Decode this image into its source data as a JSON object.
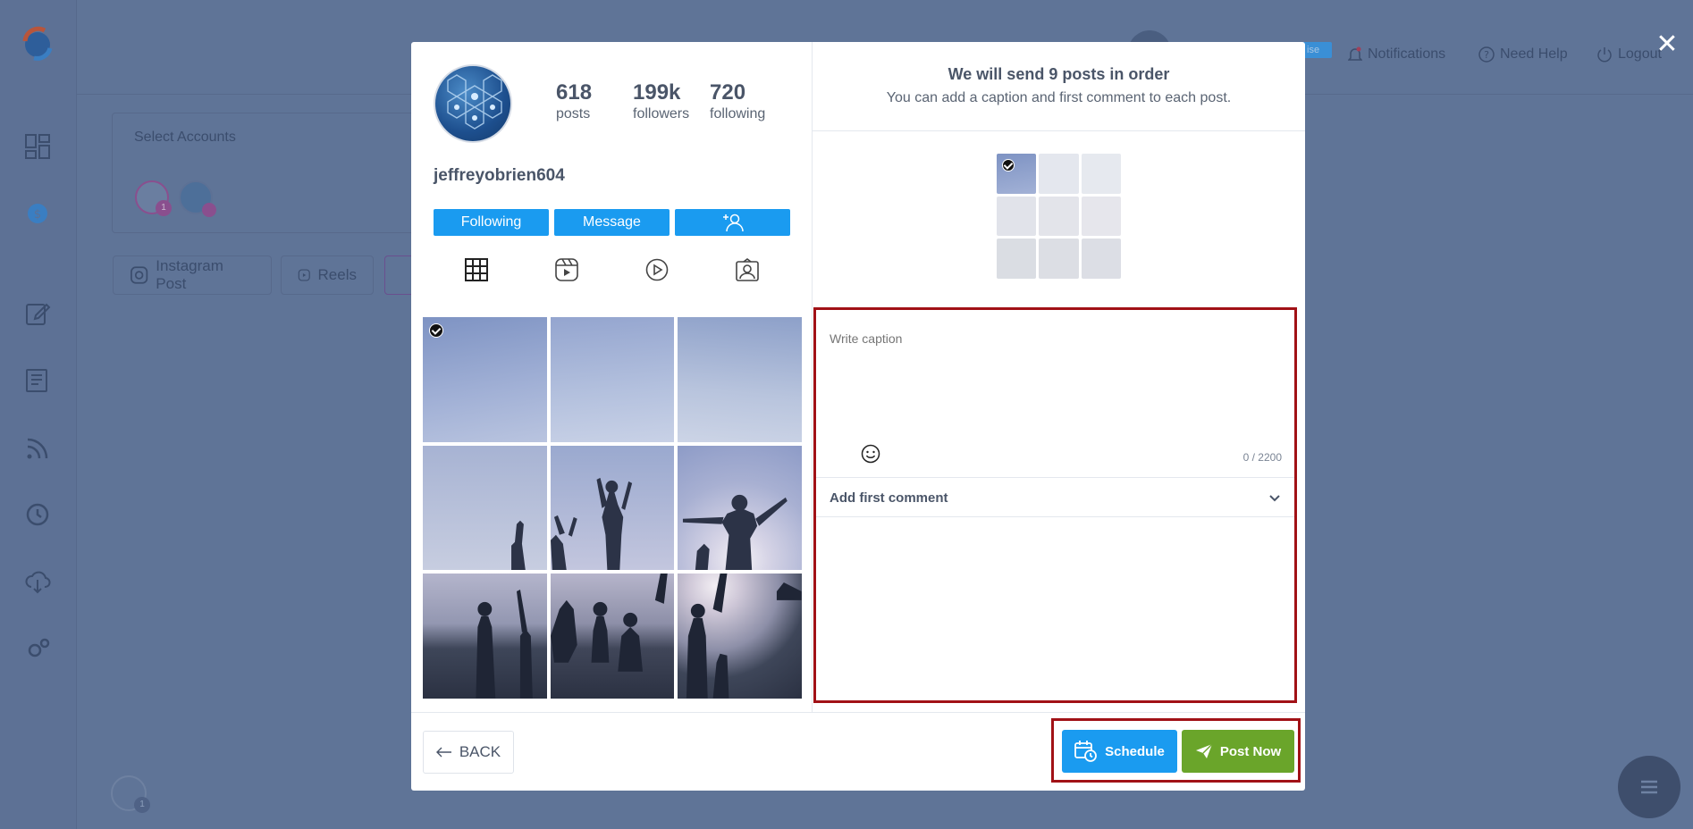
{
  "background": {
    "topbar": {
      "notifications_label": "Notifications",
      "help_label": "Need Help",
      "logout_label": "Logout",
      "badge_text": "ise"
    },
    "accounts_panel": {
      "title": "Select Accounts",
      "badge_count": "1",
      "bottom_badge": "1"
    },
    "post_tabs": {
      "instagram_post": "Instagram Post",
      "reels": "Reels"
    }
  },
  "modal": {
    "profile": {
      "username": "jeffreyobrien604",
      "stats": [
        {
          "value": "618",
          "label": "posts"
        },
        {
          "value": "199k",
          "label": "followers"
        },
        {
          "value": "720",
          "label": "following"
        }
      ],
      "buttons": {
        "following": "Following",
        "message": "Message"
      }
    },
    "header": {
      "title": "We will send 9 posts in order",
      "subtitle": "You can add a caption and first comment to each post."
    },
    "caption": {
      "placeholder": "Write caption",
      "value": "",
      "counter": "0 / 2200"
    },
    "first_comment": {
      "label": "Add first comment"
    },
    "footer": {
      "back_label": "BACK",
      "schedule_label": "Schedule",
      "post_now_label": "Post Now"
    }
  },
  "colors": {
    "primary_blue": "#1a9bf0",
    "post_green": "#6aa52a",
    "highlight_red": "#a11116",
    "overlay": "#5f7497"
  }
}
